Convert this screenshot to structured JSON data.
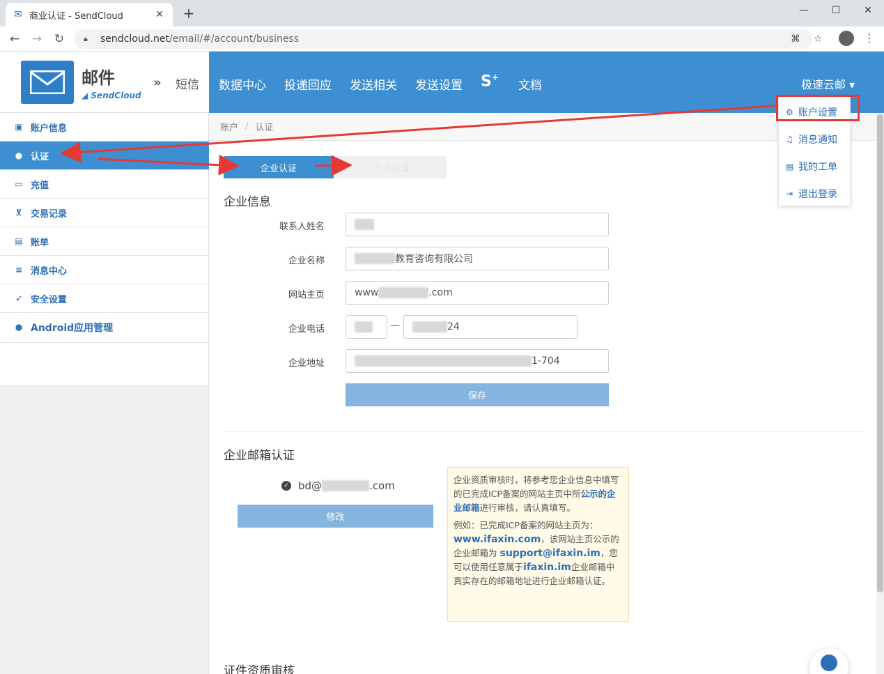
{
  "browser": {
    "tab_title": "商业认证 - SendCloud",
    "url_host": "sendcloud.net",
    "url_path": "/email/#/account/business"
  },
  "brand": {
    "title": "邮件",
    "subtitle": "SendCloud",
    "sms": "短信"
  },
  "topnav": {
    "items": [
      "数据中心",
      "投递回应",
      "发送相关",
      "发送设置",
      "文档"
    ],
    "s_plus": "S",
    "s_plus_sup": "+",
    "user": "极速云邮"
  },
  "sidebar": {
    "items": [
      {
        "label": "账户信息",
        "icon": "id-card-icon"
      },
      {
        "label": "认证",
        "icon": "verified-icon"
      },
      {
        "label": "充值",
        "icon": "credit-card-icon"
      },
      {
        "label": "交易记录",
        "icon": "cart-icon"
      },
      {
        "label": "账单",
        "icon": "bill-icon"
      },
      {
        "label": "消息中心",
        "icon": "list-icon"
      },
      {
        "label": "安全设置",
        "icon": "rocket-icon"
      },
      {
        "label": "Android应用管理",
        "icon": "android-icon"
      }
    ],
    "active_index": 1
  },
  "breadcrumb": {
    "root": "账户",
    "sep": "/",
    "current": "认证"
  },
  "tabs": {
    "enterprise": "企业认证",
    "personal": "个人认证"
  },
  "company_info": {
    "title": "企业信息",
    "contact_label": "联系人姓名",
    "company_label": "企业名称",
    "company_suffix": "教育咨询有限公司",
    "site_label": "网站主页",
    "site_prefix": "www",
    "site_suffix": ".com",
    "phone_label": "企业电话",
    "phone_dash": "—",
    "phone_suffix": "24",
    "address_label": "企业地址",
    "address_suffix": "1-704",
    "save": "保存"
  },
  "email_verify": {
    "title": "企业邮箱认证",
    "email_prefix": "bd@",
    "email_suffix": ".com",
    "edit": "修改",
    "notice_1a": "企业资质审核时，将参考您企业信息中填写的已完成ICP备案的网站主页中所",
    "notice_1b": "公示的企业邮箱",
    "notice_1c": "进行审核，请认真填写。",
    "notice_2a": "例如：已完成ICP备案的网站主页为：",
    "notice_2b": "www.ifaxin.com",
    "notice_2c": "，该网站主页公示的企业邮箱为 ",
    "notice_2d": "support@ifaxin.im",
    "notice_2e": "，您可以使用任意属于",
    "notice_2f": "ifaxin.im",
    "notice_2g": "企业邮箱中真实存在的邮箱地址进行企业邮箱认证。"
  },
  "cert": {
    "title": "证件资质审核"
  },
  "dropdown": {
    "items": [
      "账户设置",
      "消息通知",
      "我的工单",
      "退出登录"
    ]
  },
  "colors": {
    "brand_blue": "#3e8fd1",
    "link_blue": "#2f6fb5",
    "annotation_red": "#e53935"
  }
}
